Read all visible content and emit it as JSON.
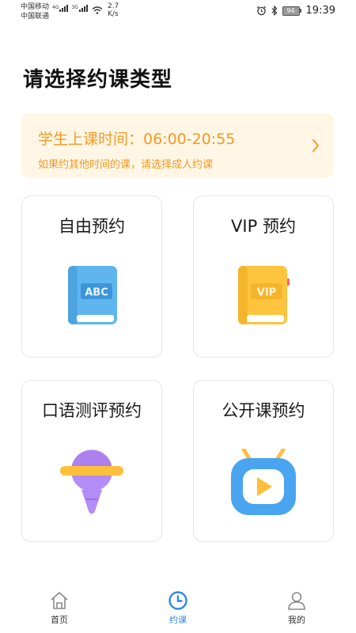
{
  "status_bar": {
    "carrier1": "中国移动",
    "carrier2": "中国联通",
    "network1": "4G",
    "network2": "3G",
    "speed_value": "2.7",
    "speed_unit": "K/s",
    "battery": "94",
    "time": "19:39"
  },
  "page_title": "请选择约课类型",
  "notice": {
    "main": "学生上课时间：06:00-20:55",
    "sub": "如果约其他时间的课，请选择成人约课"
  },
  "cards": [
    {
      "label": "自由预约",
      "icon": "abc-book-icon"
    },
    {
      "label": "VIP 预约",
      "icon": "vip-book-icon"
    },
    {
      "label": "口语测评预约",
      "icon": "planet-microphone-icon"
    },
    {
      "label": "公开课预约",
      "icon": "tv-play-icon"
    }
  ],
  "tab_bar": {
    "items": [
      {
        "label": "首页",
        "icon": "home-icon",
        "active": false
      },
      {
        "label": "约课",
        "icon": "clock-icon",
        "active": true
      },
      {
        "label": "我的",
        "icon": "person-icon",
        "active": false
      }
    ],
    "active_color": "#2f86e8"
  },
  "colors": {
    "notice_bg": "#fff6e6",
    "notice_text": "#f39a23"
  }
}
